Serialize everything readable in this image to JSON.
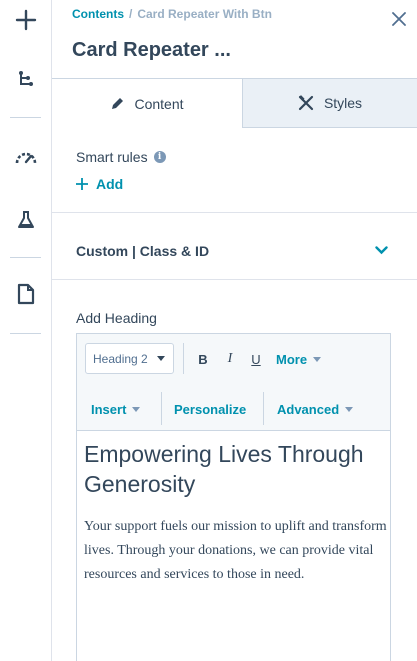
{
  "rail": {
    "items": [
      {
        "icon": "plus-icon"
      },
      {
        "icon": "tree-structure-icon"
      },
      {
        "icon": "speedometer-icon"
      },
      {
        "icon": "flask-icon"
      },
      {
        "icon": "document-icon"
      }
    ]
  },
  "header": {
    "breadcrumb": {
      "link": "Contents",
      "current": "Card Repeater With Btn"
    },
    "title": "Card Repeater ..."
  },
  "tabs": [
    {
      "label": "Content",
      "icon": "pencil-icon",
      "active": true
    },
    {
      "label": "Styles",
      "icon": "paint-tools-icon",
      "active": false
    }
  ],
  "smart_rules": {
    "label": "Smart rules",
    "add_label": "Add"
  },
  "custom_section": {
    "title": "Custom | Class & ID"
  },
  "heading_field": {
    "label": "Add Heading",
    "toolbar": {
      "format_value": "Heading 2",
      "bold": "B",
      "italic": "I",
      "underline": "U",
      "more": "More",
      "insert": "Insert",
      "personalize": "Personalize",
      "advanced": "Advanced"
    },
    "heading_text": "Empowering Lives Through Generosity",
    "paragraph_lines": [
      "Your support fuels our mission to uplift and transform lives. Through your donations, we can provide vital",
      "resources and services to those in need."
    ]
  },
  "colors": {
    "link": "#0091ae",
    "text": "#33475b",
    "border": "#cbd6e2",
    "inactive_tab_bg": "#eaf0f6"
  }
}
